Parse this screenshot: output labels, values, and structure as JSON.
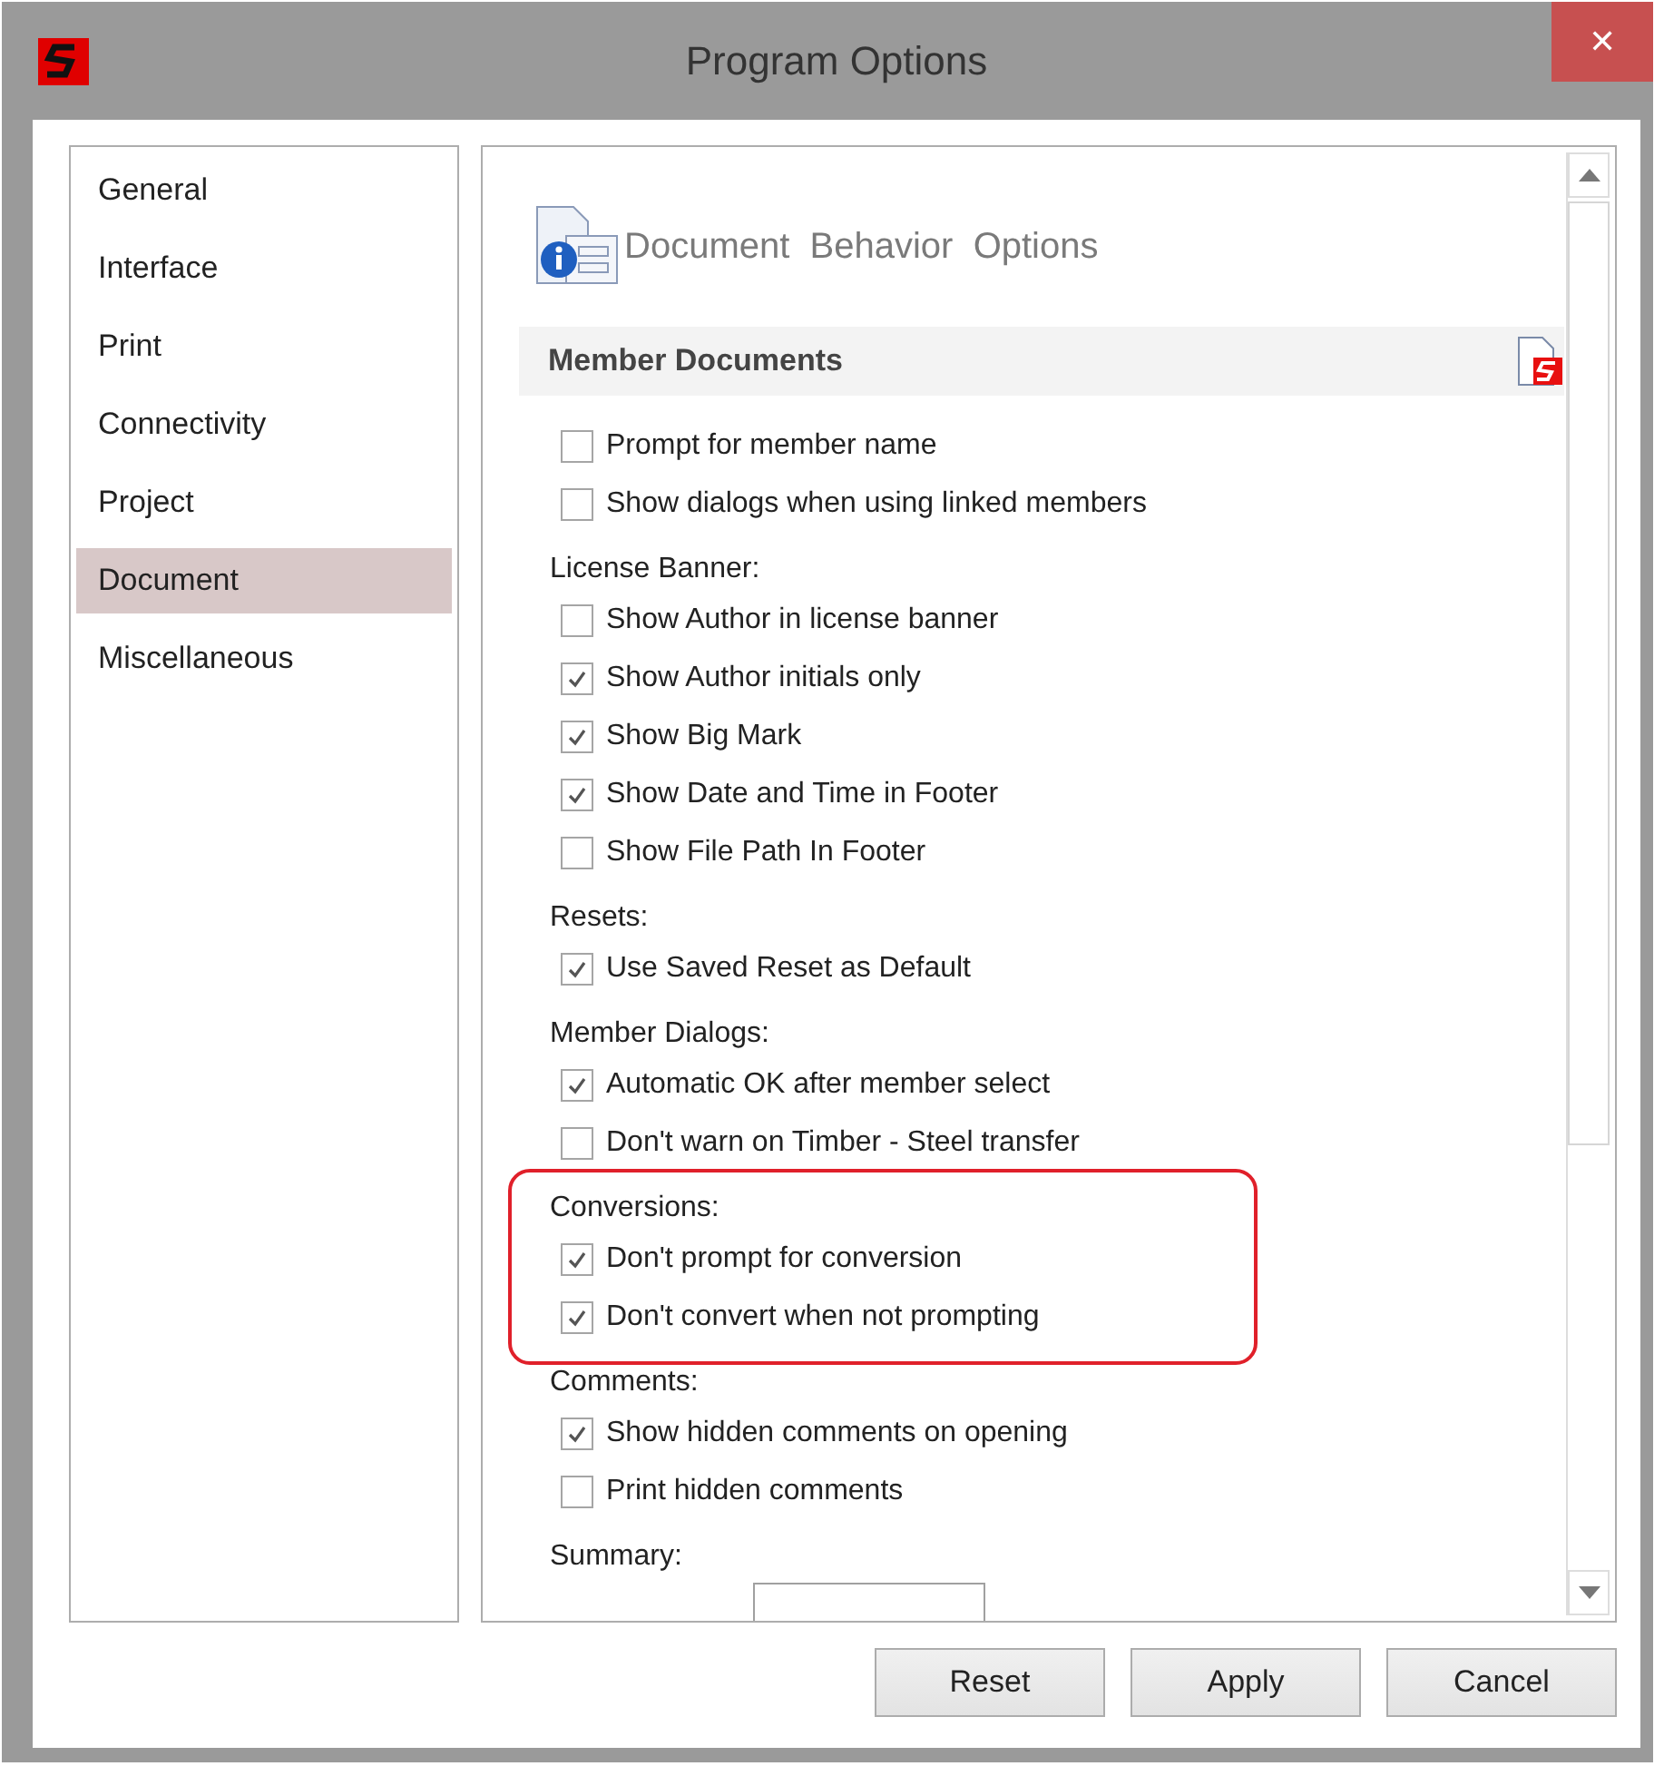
{
  "window": {
    "title": "Program Options",
    "close": "✕"
  },
  "sidebar": {
    "items": [
      {
        "label": "General",
        "selected": false
      },
      {
        "label": "Interface",
        "selected": false
      },
      {
        "label": "Print",
        "selected": false
      },
      {
        "label": "Connectivity",
        "selected": false
      },
      {
        "label": "Project",
        "selected": false
      },
      {
        "label": "Document",
        "selected": true
      },
      {
        "label": "Miscellaneous",
        "selected": false
      }
    ]
  },
  "page": {
    "title": "Document  Behavior  Options",
    "section": "Member Documents",
    "groups": [
      {
        "highlighted": false,
        "items": [
          {
            "kind": "checkbox",
            "label": "Prompt for member name",
            "checked": false
          },
          {
            "kind": "checkbox",
            "label": "Show dialogs when using linked members",
            "checked": false
          }
        ]
      },
      {
        "label": "License Banner:",
        "highlighted": false,
        "items": [
          {
            "kind": "checkbox",
            "label": "Show Author in license banner",
            "checked": false
          },
          {
            "kind": "checkbox",
            "label": "Show Author initials only",
            "checked": true
          },
          {
            "kind": "checkbox",
            "label": "Show Big Mark",
            "checked": true
          },
          {
            "kind": "checkbox",
            "label": "Show Date and Time in Footer",
            "checked": true
          },
          {
            "kind": "checkbox",
            "label": "Show File Path In Footer",
            "checked": false
          }
        ]
      },
      {
        "label": "Resets:",
        "highlighted": false,
        "items": [
          {
            "kind": "checkbox",
            "label": "Use Saved Reset as Default",
            "checked": true
          }
        ]
      },
      {
        "label": "Member Dialogs:",
        "highlighted": false,
        "items": [
          {
            "kind": "checkbox",
            "label": "Automatic OK after member select",
            "checked": true
          },
          {
            "kind": "checkbox",
            "label": "Don't warn on Timber - Steel transfer",
            "checked": false
          }
        ]
      },
      {
        "label": "Conversions:",
        "highlighted": true,
        "items": [
          {
            "kind": "checkbox",
            "label": "Don't prompt for conversion",
            "checked": true
          },
          {
            "kind": "checkbox",
            "label": "Don't convert when not prompting",
            "checked": true
          }
        ]
      },
      {
        "label": "Comments:",
        "highlighted": false,
        "items": [
          {
            "kind": "checkbox",
            "label": "Show hidden comments on opening",
            "checked": true
          },
          {
            "kind": "checkbox",
            "label": "Print hidden comments",
            "checked": false
          }
        ]
      },
      {
        "label": "Summary:",
        "highlighted": false,
        "items": [
          {
            "kind": "dropdown"
          }
        ]
      }
    ]
  },
  "buttons": [
    "Reset",
    "Apply",
    "Cancel"
  ]
}
